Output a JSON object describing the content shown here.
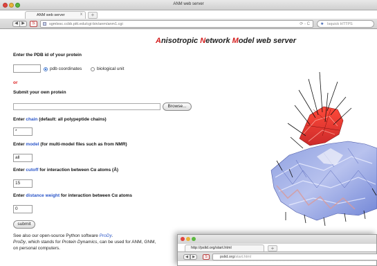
{
  "window": {
    "title": "ANM web server"
  },
  "tab": {
    "label": "ANM web server",
    "close": "x",
    "new_tab": "+"
  },
  "toolbar": {
    "back": "◀",
    "forward": "▶",
    "url": "sgmlesc.ccbb.pitt.edu/cgi-bin/anm/anm1.cgi",
    "reload": "⟳ - C",
    "search_engine": "★",
    "search_placeholder": "Isquick HTTPS"
  },
  "page": {
    "title_parts": [
      {
        "text": "A",
        "red": true
      },
      {
        "text": "nisotropic ",
        "red": false
      },
      {
        "text": "N",
        "red": true
      },
      {
        "text": "etwork ",
        "red": false
      },
      {
        "text": "M",
        "red": true
      },
      {
        "text": "odel web server",
        "red": false
      }
    ],
    "pdb_label": "Enter the PDB id of your protein",
    "pdb_value": "",
    "radio_pdb": "pdb coordinates",
    "radio_bio": "biological unit",
    "or_text": "or",
    "submit_own_label": "Submit your own protein",
    "browse_button": "Browse...",
    "chain_label_pre": "Enter ",
    "chain_label_link": "chain",
    "chain_label_post": " (default: all polypeptide chains)",
    "chain_value": "*",
    "model_label_pre": "Enter ",
    "model_label_link": "model",
    "model_label_post": " (for multi-model files such as from NMR)",
    "model_value": "all",
    "cutoff_label_pre": "Enter ",
    "cutoff_label_link": "cutoff",
    "cutoff_label_post": " for interaction between Cα atoms (Å)",
    "cutoff_value": "15",
    "distance_label_pre": "Enter ",
    "distance_label_link": "distance weight",
    "distance_label_post": " for interaction between Cα atoms",
    "distance_value": "0",
    "submit_button": "submit",
    "footnote1_pre": "See also our open-source Python software ",
    "footnote1_link": "ProDy",
    "footnote1_post": ".",
    "footnote2_a": "ProDy",
    "footnote2_b": ", which stands for ",
    "footnote2_c": "Protein Dynamics",
    "footnote2_d": ", can be used for ANM, GNM,",
    "footnote3": "on personal computers."
  },
  "second_window": {
    "tab_label": "http://pslid.org/start.html",
    "new_tab": "+",
    "url_domain": "pslid.org",
    "url_path": "/start.html"
  },
  "colors": {
    "accent_red": "#d41c1c",
    "link_blue": "#2a55c8"
  }
}
